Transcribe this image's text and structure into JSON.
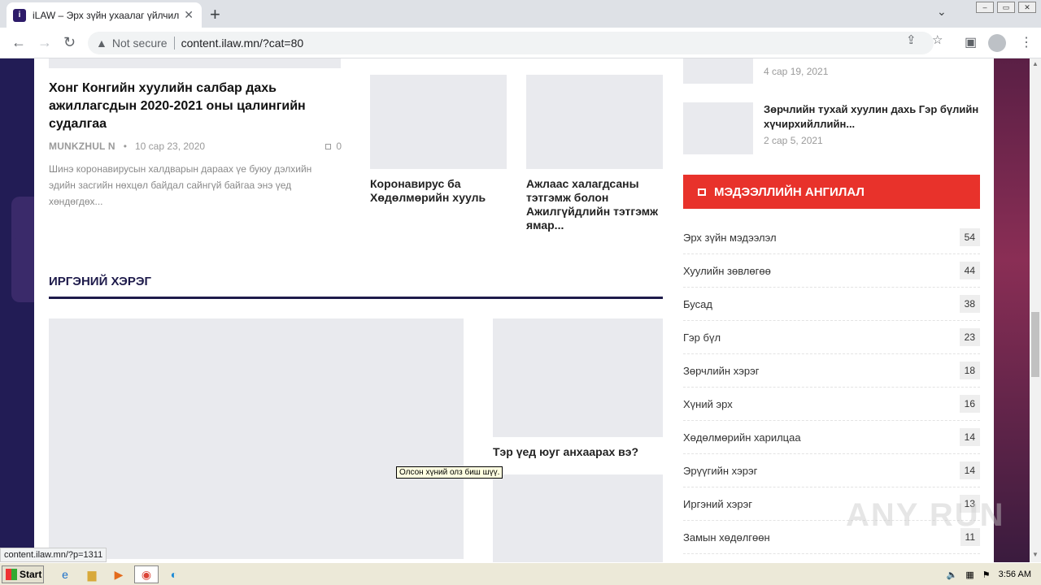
{
  "browser": {
    "tab_title": "iLAW – Эрх зүйн ухаалаг үйлчилгээ",
    "favicon_letter": "i",
    "not_secure": "Not secure",
    "url": "content.ilaw.mn/?cat=80",
    "status_url": "content.ilaw.mn/?p=1311"
  },
  "featured": {
    "title": "Хонг Конгийн хуулийн салбар дахь ажиллагсдын 2020-2021 оны цалингийн судалгаа",
    "author": "MUNKZHUL N",
    "date": "10 сар 23, 2020",
    "comments": "0",
    "excerpt": "Шинэ коронавирусын халдварын дараах үе буюу дэлхийн эдийн засгийн нөхцөл байдал сайнгүй байгаа энэ үед хөндөгдөх..."
  },
  "cards": [
    {
      "title": "Коронавирус ба Хөдөлмөрийн хууль"
    },
    {
      "title": "Ажлаас халагдсаны тэтгэмж болон Ажилгүйдлийн тэтгэмж ямар..."
    }
  ],
  "section": {
    "heading": "ИРГЭНИЙ ХЭРЭГ",
    "card_title": "Тэр үед юуг анхаарах вэ?",
    "tooltip": "Олсон хүний олз биш шүү."
  },
  "sidebar": {
    "posts": [
      {
        "date": "4 сар 19, 2021"
      },
      {
        "title": "Зөрчлийн тухай хуулин дахь Гэр бүлийн хүчирхийллийн...",
        "date": "2 сар 5, 2021"
      }
    ],
    "categories_title": "МЭДЭЭЛЛИЙН АНГИЛАЛ",
    "categories": [
      {
        "name": "Эрх зүйн мэдээлэл",
        "count": "54"
      },
      {
        "name": "Хуулийн зөвлөгөө",
        "count": "44"
      },
      {
        "name": "Бусад",
        "count": "38"
      },
      {
        "name": "Гэр бүл",
        "count": "23"
      },
      {
        "name": "Зөрчлийн хэрэг",
        "count": "18"
      },
      {
        "name": "Хүний эрх",
        "count": "16"
      },
      {
        "name": "Хөдөлмөрийн харилцаа",
        "count": "14"
      },
      {
        "name": "Эрүүгийн хэрэг",
        "count": "14"
      },
      {
        "name": "Иргэний хэрэг",
        "count": "13"
      },
      {
        "name": "Замын хөдөлгөөн",
        "count": "11"
      }
    ]
  },
  "watermark": "ANY RUN",
  "taskbar": {
    "start_label": "Start",
    "clock": "3:56 AM"
  },
  "colors": {
    "brand_navy": "#1e1b4b",
    "accent_red": "#e8322b"
  }
}
